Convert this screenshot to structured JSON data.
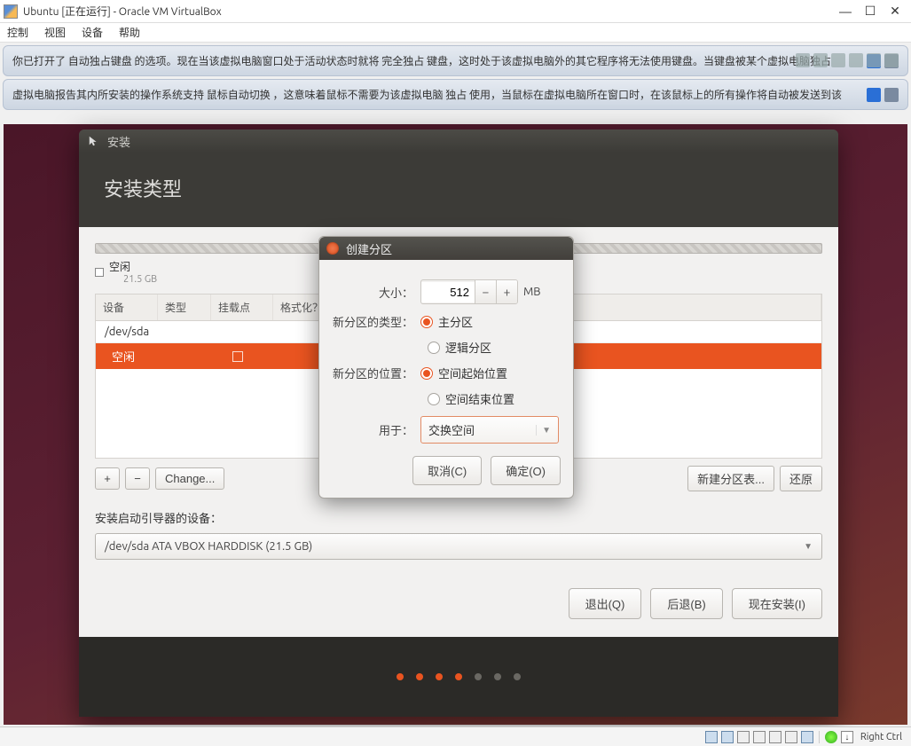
{
  "window": {
    "title": "Ubuntu [正在运行] - Oracle VM VirtualBox",
    "menu": [
      "控制",
      "视图",
      "设备",
      "帮助"
    ]
  },
  "hints": {
    "banner1": "你已打开了 自动独占键盘 的选项。现在当该虚拟电脑窗口处于活动状态时就将 完全独占 键盘，这时处于该虚拟电脑外的其它程序将无法使用键盘。当键盘被某个虚拟电脑独占",
    "banner2": "虚拟电脑报告其内所安装的操作系统支持 鼠标自动切换 ，这意味着鼠标不需要为该虚拟电脑 独占 使用，当鼠标在虚拟电脑所在窗口时，在该鼠标上的所有操作将自动被发送到该"
  },
  "installer": {
    "titlebar": "安装",
    "header": "安装类型",
    "legend_label": "空闲",
    "legend_size": "21.5 GB",
    "columns": {
      "device": "设备",
      "type": "类型",
      "mount": "挂载点",
      "format": "格式化？"
    },
    "device_row": "/dev/sda",
    "free_row": "空闲",
    "btn_plus": "+",
    "btn_minus": "−",
    "btn_change": "Change...",
    "btn_newtable": "新建分区表...",
    "btn_revert": "还原",
    "bootloader_label": "安装启动引导器的设备：",
    "bootloader_value": "/dev/sda  ATA VBOX HARDDISK (21.5 GB)",
    "btn_quit": "退出(Q)",
    "btn_back": "后退(B)",
    "btn_install": "现在安装(I)"
  },
  "dialog": {
    "title": "创建分区",
    "size_label": "大小：",
    "size_value": "512",
    "size_unit": "MB",
    "type_label": "新分区的类型：",
    "type_primary": "主分区",
    "type_logical": "逻辑分区",
    "location_label": "新分区的位置：",
    "location_begin": "空间起始位置",
    "location_end": "空间结束位置",
    "use_label": "用于：",
    "use_value": "交换空间",
    "btn_cancel": "取消(C)",
    "btn_ok": "确定(O)"
  },
  "status": {
    "hostkey": "Right Ctrl"
  }
}
